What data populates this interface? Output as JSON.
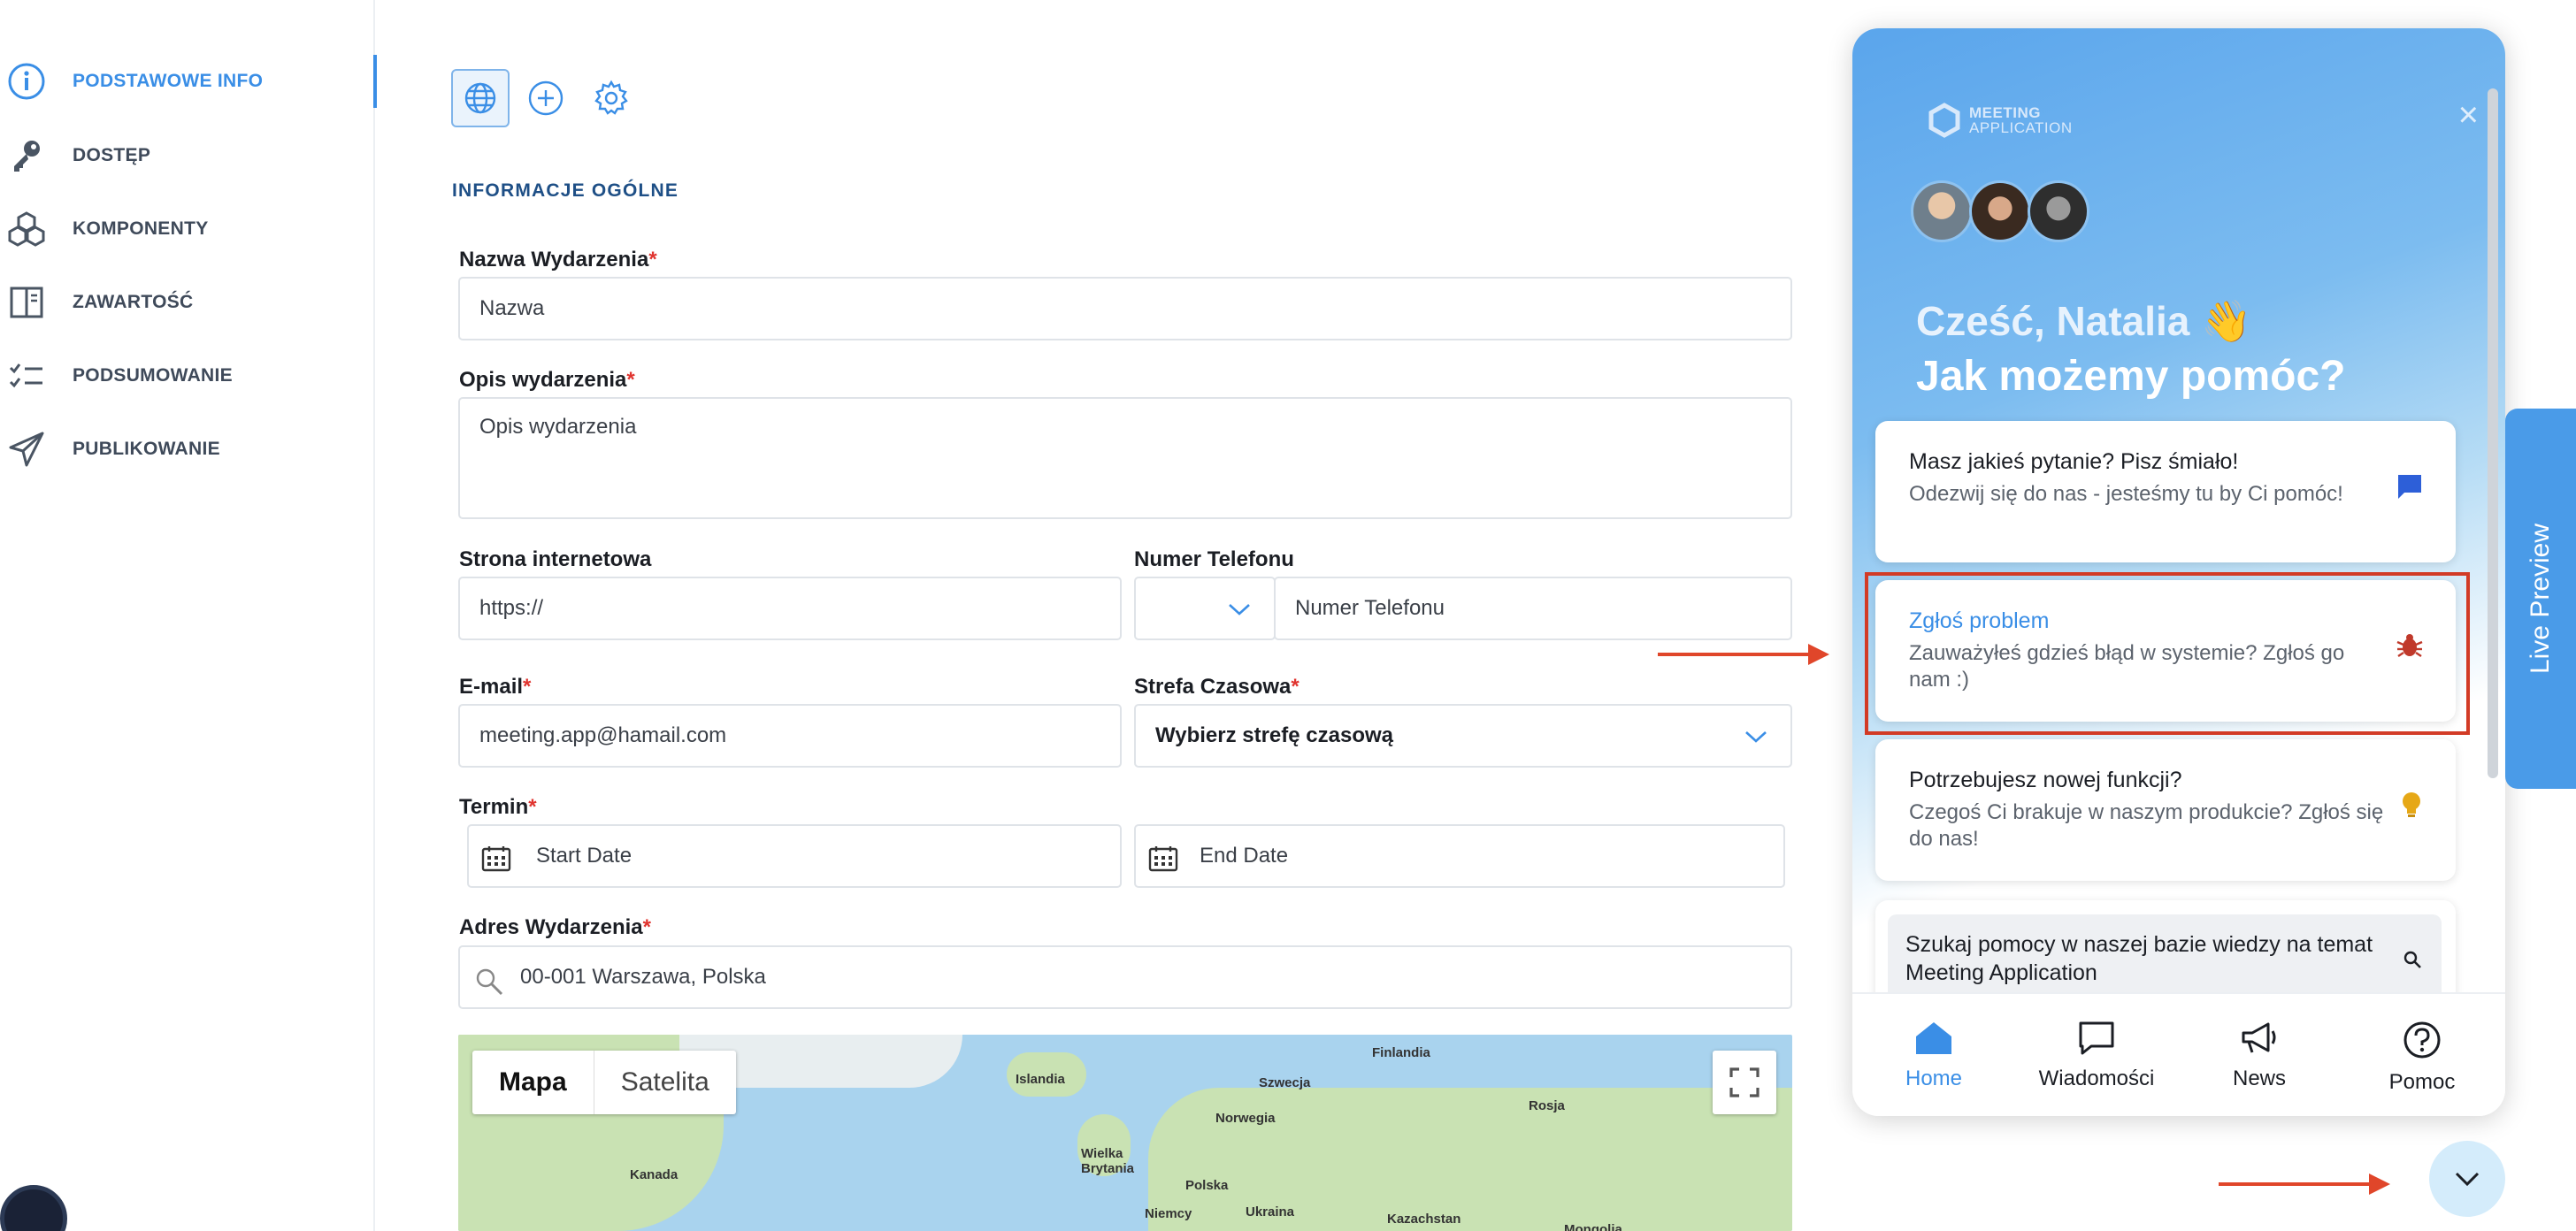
{
  "sidebar": {
    "items": [
      {
        "label": "PODSTAWOWE INFO",
        "icon": "info-icon"
      },
      {
        "label": "DOSTĘP",
        "icon": "key-icon"
      },
      {
        "label": "KOMPONENTY",
        "icon": "components-icon"
      },
      {
        "label": "ZAWARTOŚĆ",
        "icon": "book-icon"
      },
      {
        "label": "PODSUMOWANIE",
        "icon": "checklist-icon"
      },
      {
        "label": "PUBLIKOWANIE",
        "icon": "paper-plane-icon"
      }
    ]
  },
  "toolbar": {
    "icons": [
      "globe-icon",
      "plus-circle-icon",
      "gear-icon"
    ]
  },
  "form": {
    "section_title": "INFORMACJE OGÓLNE",
    "name_label": "Nazwa Wydarzenia",
    "name_placeholder": "Nazwa",
    "desc_label": "Opis wydarzenia",
    "desc_placeholder": "Opis wydarzenia",
    "website_label": "Strona internetowa",
    "website_value": "https://",
    "phone_label": "Numer Telefonu",
    "phone_placeholder": "Numer Telefonu",
    "email_label": "E-mail",
    "email_value": "meeting.app@hamail.com",
    "timezone_label": "Strefa Czasowa",
    "timezone_value": "Wybierz strefę czasową",
    "term_label": "Termin",
    "start_placeholder": "Start Date",
    "end_placeholder": "End Date",
    "address_label": "Adres Wydarzenia",
    "address_value": "00-001 Warszawa, Polska",
    "required_mark": "*"
  },
  "map": {
    "tab_map": "Mapa",
    "tab_satellite": "Satelita",
    "labels": [
      "Islandia",
      "Szwecja",
      "Finlandia",
      "Norwegia",
      "Rosja",
      "Wielka Brytania",
      "Polska",
      "Niemcy",
      "Ukraina",
      "Kanada",
      "Kazachstan",
      "Mongolia"
    ]
  },
  "widget": {
    "logo_line1": "MEETING",
    "logo_line2": "APPLICATION",
    "close": "×",
    "greeting": "Cześć, Natalia 👋",
    "subgreeting": "Jak możemy pomóc?",
    "cards": [
      {
        "title": "Masz jakieś pytanie? Pisz śmiało!",
        "desc": "Odezwij się do nas - jesteśmy tu by Ci pomóc!",
        "icon": "chat-bubble-icon",
        "color": "#2d5fd8"
      },
      {
        "title": "Zgłoś problem",
        "desc": "Zauważyłeś gdzieś błąd w systemie? Zgłoś go nam :)",
        "icon": "bug-icon",
        "color": "#c0392b"
      },
      {
        "title": "Potrzebujesz nowej funkcji?",
        "desc": "Czegoś Ci brakuje w naszym produkcie? Zgłoś się do nas!",
        "icon": "lightbulb-icon",
        "color": "#e6a817"
      }
    ],
    "search_text": "Szukaj pomocy w naszej bazie wiedzy na temat Meeting Application",
    "nav": [
      {
        "label": "Home",
        "icon": "home-icon"
      },
      {
        "label": "Wiadomości",
        "icon": "messages-icon"
      },
      {
        "label": "News",
        "icon": "megaphone-icon"
      },
      {
        "label": "Pomoc",
        "icon": "help-icon"
      }
    ]
  },
  "live_preview": "Live Preview",
  "colors": {
    "accent": "#3a8ee6",
    "required": "#e0342f",
    "annotation": "#e0462a"
  }
}
